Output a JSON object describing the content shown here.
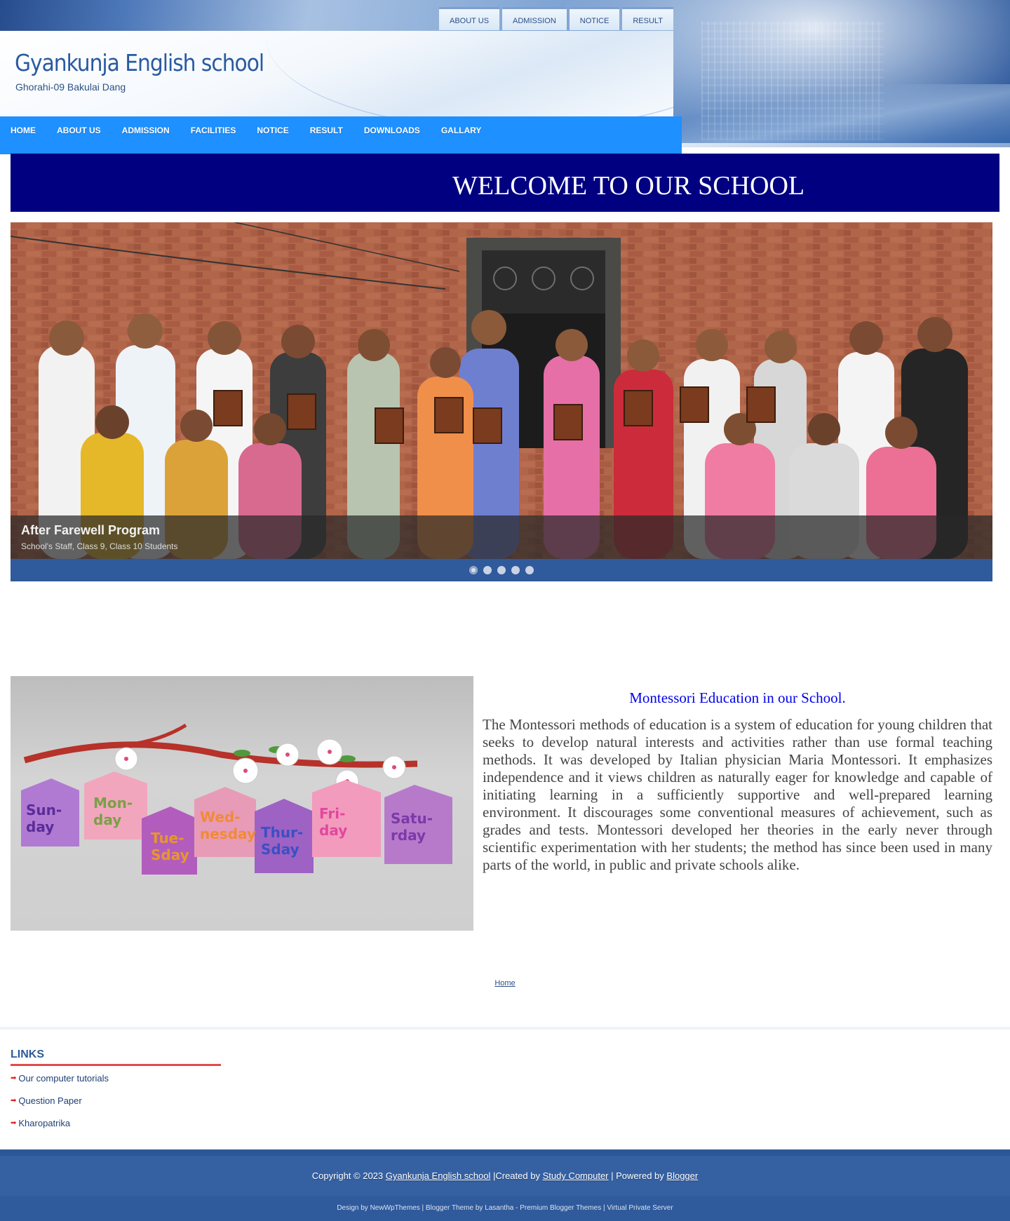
{
  "header": {
    "top_tabs": [
      "ABOUT US",
      "ADMISSION",
      "NOTICE",
      "RESULT"
    ],
    "site_title": "Gyankunja English school",
    "site_description": "Ghorahi-09 Bakulai Dang"
  },
  "main_nav": [
    "HOME",
    "ABOUT US",
    "ADMISSION",
    "FACILITIES",
    "NOTICE",
    "RESULT",
    "DOWNLOADS",
    "GALLARY"
  ],
  "welcome_banner": "WELCOME TO OUR SCHOOL",
  "slider": {
    "caption_title": "After Farewell Program",
    "caption_subtitle": "School's Staff, Class 9, Class 10 Students",
    "slide_count": 5,
    "active_slide": 1
  },
  "montessori": {
    "title": "Montessori Education in our School.",
    "body": "The Montessori methods of education is a system of education for young children that seeks to develop natural interests and activities rather than use formal teaching methods. It was developed by Italian physician Maria Montessori. It emphasizes independence and it views children as naturally eager for knowledge and capable of initiating learning in a sufficiently supportive and well-prepared learning environment. It discourages some conventional measures of achievement, such as grades and tests. Montessori developed her theories in the early never through scientific experimentation with her students; the method has since been used in many parts of the world, in public and private schools alike.",
    "image_labels": [
      "Sun-day",
      "Mon-day",
      "Tue-sday",
      "Wed-nesday",
      "Thur-sday",
      "Fri-day",
      "Satu-rday"
    ]
  },
  "home_link": "Home",
  "links_widget": {
    "title": "LINKS",
    "items": [
      "Our computer tutorials",
      "Question Paper",
      "Kharopatrika"
    ]
  },
  "footer": {
    "copyright_prefix": "Copyright © 2023",
    "site_link": "Gyankunja English school",
    "created_by_text": "|Created by",
    "created_by_link": "Study Computer",
    "powered_by_text": "| Powered by",
    "powered_by_link": "Blogger",
    "credits": {
      "design_prefix": "Design by",
      "design_link": "NewWpThemes",
      "theme_text": "| Blogger Theme by",
      "theme_link": "Lasantha - Premium Blogger Themes",
      "separator": "|",
      "vps_link": "Virtual Private Server"
    }
  },
  "colors": {
    "nav_blue": "#1e90ff",
    "banner_navy": "#000080",
    "footer_blue": "#2f5a9b",
    "title_blue": "#2a5aa0",
    "accent_red": "#e04c4c"
  }
}
